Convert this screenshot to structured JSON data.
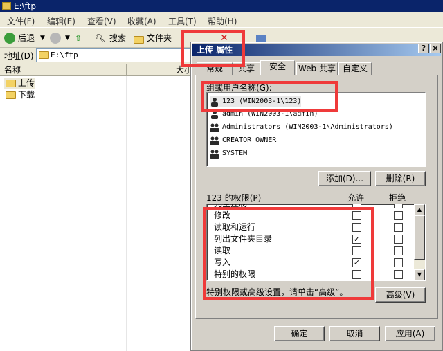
{
  "window": {
    "title": "E:\\ftp"
  },
  "menu": [
    "文件(F)",
    "编辑(E)",
    "查看(V)",
    "收藏(A)",
    "工具(T)",
    "帮助(H)"
  ],
  "toolbar": {
    "back": "后退",
    "search": "搜索",
    "folders": "文件夹"
  },
  "address": {
    "label": "地址(D)",
    "value": "E:\\ftp"
  },
  "list": {
    "columns": [
      "名称",
      "大小"
    ],
    "items": [
      "上传",
      "下载"
    ]
  },
  "dialog": {
    "title": "上传 属性",
    "help_btn": "?",
    "close_btn": "×",
    "tabs": [
      "常规",
      "共享",
      "安全",
      "Web 共享",
      "自定义"
    ],
    "users_label": "组或用户名称(G):",
    "users": [
      "123 (WIN2003-1\\123)",
      "admin (WIN2003-1\\admin)",
      "Administrators (WIN2003-1\\Administrators)",
      "CREATOR OWNER",
      "SYSTEM"
    ],
    "add_btn": "添加(D)...",
    "remove_btn": "删除(R)",
    "perm_label": "123 的权限(P)",
    "allow_label": "允许",
    "deny_label": "拒绝",
    "permissions": [
      {
        "name": "完全控制",
        "allow": false,
        "deny": false
      },
      {
        "name": "修改",
        "allow": false,
        "deny": false
      },
      {
        "name": "读取和运行",
        "allow": false,
        "deny": false
      },
      {
        "name": "列出文件夹目录",
        "allow": true,
        "deny": false
      },
      {
        "name": "读取",
        "allow": false,
        "deny": false
      },
      {
        "name": "写入",
        "allow": true,
        "deny": false
      },
      {
        "name": "特别的权限",
        "allow": false,
        "deny": false
      }
    ],
    "advanced_hint": "特别权限或高级设置，请单击“高级”。",
    "advanced_btn": "高级(V)",
    "ok_btn": "确定",
    "cancel_btn": "取消",
    "apply_btn": "应用(A)"
  }
}
